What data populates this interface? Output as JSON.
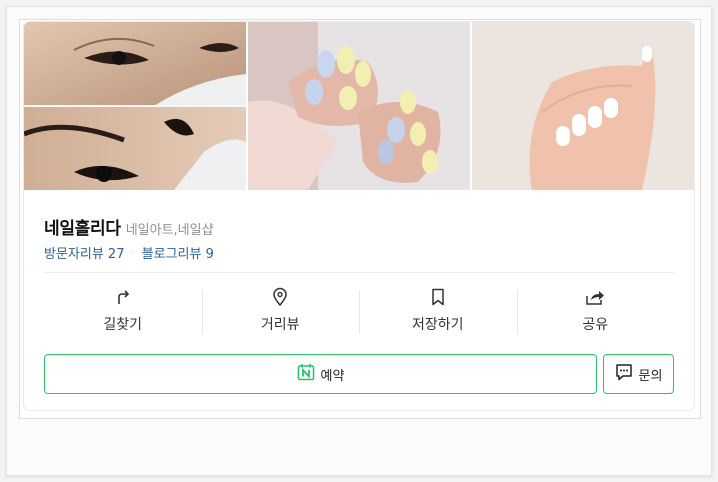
{
  "place": {
    "name": "네일홀리다",
    "category": "네일아트,네일샵"
  },
  "reviews": {
    "visitor_label": "방문자리뷰 27",
    "blog_label": "블로그리뷰 9",
    "separator": "·"
  },
  "actions": [
    {
      "label": "길찾기",
      "icon": "directions-icon"
    },
    {
      "label": "거리뷰",
      "icon": "location-pin-icon"
    },
    {
      "label": "저장하기",
      "icon": "bookmark-icon"
    },
    {
      "label": "공유",
      "icon": "share-icon"
    }
  ],
  "buttons": {
    "reserve_label": "예약",
    "inquiry_label": "문의"
  },
  "photos": [
    {
      "subject": "eyes-closeup-photo"
    },
    {
      "subject": "crystal-nail-art-photo"
    },
    {
      "subject": "white-nails-photo"
    }
  ],
  "colors": {
    "accent_green": "#2cc36b",
    "link_blue": "#2e5f9b"
  }
}
